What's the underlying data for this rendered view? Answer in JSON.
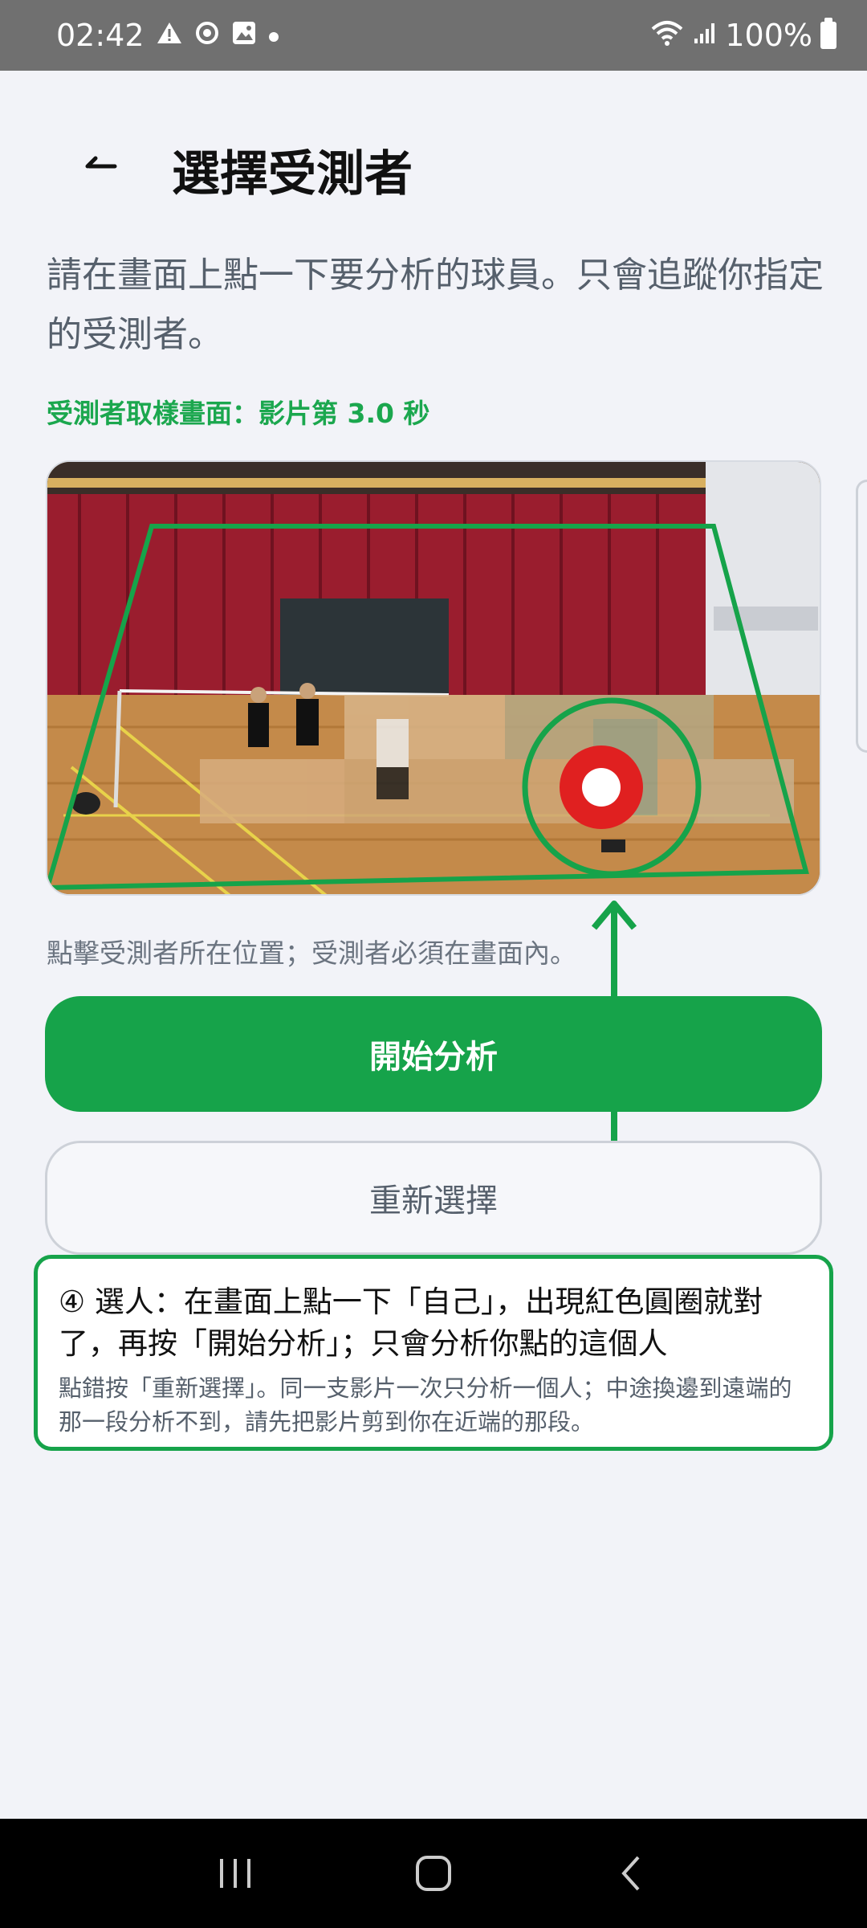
{
  "status_bar": {
    "time": "02:42",
    "battery": "100%",
    "icons": [
      "warning-icon",
      "sync-icon",
      "image-icon",
      "dot-icon",
      "wifi-icon",
      "signal-icon",
      "battery-icon"
    ]
  },
  "header": {
    "title": "選擇受測者",
    "back_icon": "back-arrow-icon"
  },
  "instructions": "請在畫面上點一下要分析的球員。只會追蹤你指定的受測者。",
  "sample_label": "受測者取樣畫面：影片第 3.0 秒",
  "hint": "點擊受測者所在位置；受測者必須在畫面內。",
  "buttons": {
    "start": "開始分析",
    "reselect": "重新選擇"
  },
  "tip": {
    "title": "④ 選人：在畫面上點一下「自己」，出現紅色圓圈就對了，再按「開始分析」；只會分析你點的這個人",
    "body": "點錯按「重新選擇」。同一支影片一次只分析一個人；中途換邊到遠端的那一段分析不到，請先把影片剪到你在近端的那段。"
  },
  "colors": {
    "accent": "#16a34a",
    "status_bar": "#707070",
    "background": "#f2f3f8",
    "marker": "#e02020"
  },
  "nav": {
    "icons": [
      "recent-apps-icon",
      "home-icon",
      "back-icon"
    ]
  }
}
